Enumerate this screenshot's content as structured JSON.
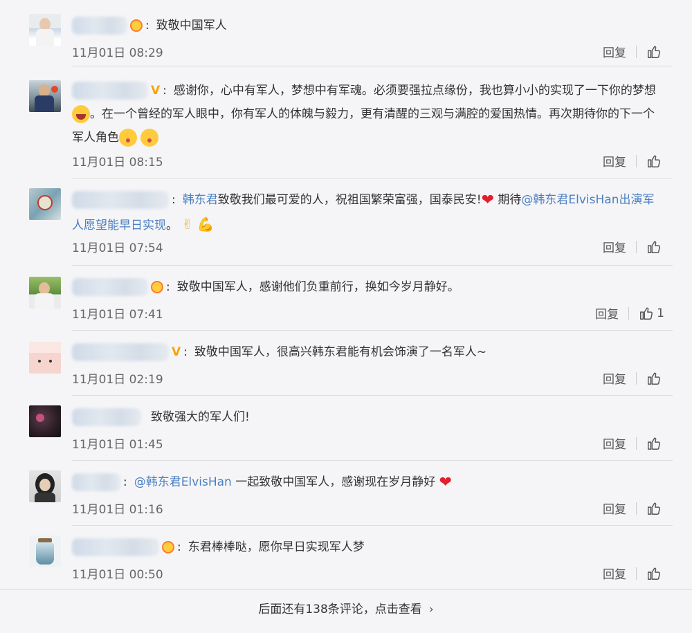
{
  "comments": [
    {
      "time": "11月01日 08:29",
      "badge": "crown",
      "text": "致敬中国军人",
      "reply": "回复",
      "likes": ""
    },
    {
      "time": "11月01日 08:15",
      "badge": "v",
      "text": "感谢你，心中有军人，梦想中有军魂。必须要强拉点缘份，我也算小小的实现了一下你的梦想",
      "text2": "。在一个曾经的军人眼中，你有军人的体魄与毅力，更有清醒的三观与满腔的爱国热情。再次期待你的下一个军人角色",
      "reply": "回复",
      "likes": ""
    },
    {
      "time": "11月01日 07:54",
      "badge": "",
      "mention1": "韩东君",
      "text": "致敬我们最可爱的人，祝祖国繁荣富强，国泰民安!",
      "text_mid": "期待",
      "mention2": "@韩东君ElvisHan出演军人愿望能早日实现",
      "text_end": "。",
      "reply": "回复",
      "likes": ""
    },
    {
      "time": "11月01日 07:41",
      "badge": "crown",
      "text": "致敬中国军人，感谢他们负重前行，换如今岁月静好。",
      "reply": "回复",
      "likes": "1"
    },
    {
      "time": "11月01日 02:19",
      "badge": "v",
      "text": "致敬中国军人，很高兴韩东君能有机会饰演了一名军人~",
      "reply": "回复",
      "likes": ""
    },
    {
      "time": "11月01日 01:45",
      "badge": "",
      "text": "致敬强大的军人们!",
      "reply": "回复",
      "likes": ""
    },
    {
      "time": "11月01日 01:16",
      "badge": "",
      "mention1": "@韩东君ElvisHan",
      "text": "一起致敬中国军人，感谢现在岁月静好",
      "reply": "回复",
      "likes": ""
    },
    {
      "time": "11月01日 00:50",
      "badge": "crown",
      "text": "东君棒棒哒，愿你早日实现军人梦",
      "reply": "回复",
      "likes": ""
    }
  ],
  "more": {
    "label": "后面还有138条评论，点击查看"
  },
  "icons": {
    "like": "thumbs-up-icon",
    "chevron": "chevron-right-icon"
  },
  "colors": {
    "mention": "#4a7fc1",
    "heart": "#e0202c",
    "v_badge": "#f7a300"
  }
}
